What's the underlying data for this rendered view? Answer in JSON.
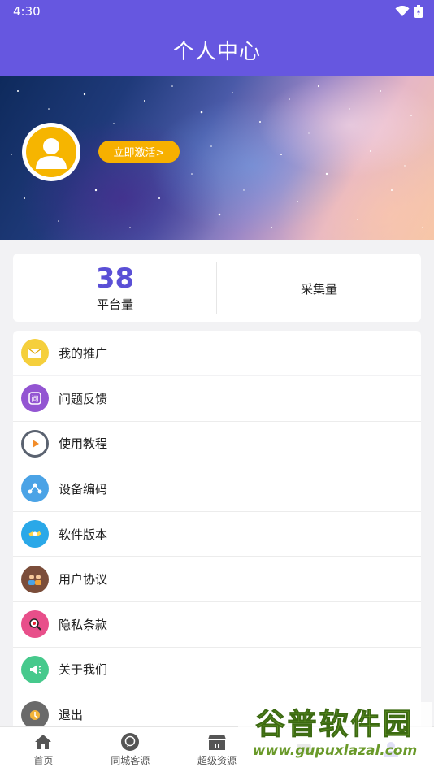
{
  "status_bar": {
    "time": "4:30"
  },
  "header": {
    "title": "个人中心"
  },
  "profile": {
    "activate_label": "立即激活>"
  },
  "stats": [
    {
      "value": "38",
      "label": "平台量"
    },
    {
      "value": "",
      "label": "采集量"
    }
  ],
  "menu": {
    "first": {
      "label": "我的推广",
      "icon": "mail-box-icon",
      "color": "#f5cf3c"
    },
    "items": [
      {
        "label": "问题反馈",
        "icon": "question-icon",
        "color": "#9355d2"
      },
      {
        "label": "使用教程",
        "icon": "play-circle-icon",
        "color": "#f28c28"
      },
      {
        "label": "设备编码",
        "icon": "network-icon",
        "color": "#4ba3e6"
      },
      {
        "label": "软件版本",
        "icon": "satellite-icon",
        "color": "#2aa8e8"
      },
      {
        "label": "用户协议",
        "icon": "users-icon",
        "color": "#7b4d3a"
      },
      {
        "label": "隐私条款",
        "icon": "magnifier-icon",
        "color": "#e84f8a"
      },
      {
        "label": "关于我们",
        "icon": "megaphone-icon",
        "color": "#46c98c"
      },
      {
        "label": "退出",
        "icon": "exit-icon",
        "color": "#6a6a6a"
      }
    ]
  },
  "tabs": [
    {
      "label": "首页",
      "icon": "home-icon"
    },
    {
      "label": "同城客源",
      "icon": "chat-icon"
    },
    {
      "label": "超级资源",
      "icon": "store-icon"
    },
    {
      "label": "",
      "icon": "tab-icon-4"
    },
    {
      "label": "",
      "icon": "profile-icon"
    }
  ],
  "watermark": {
    "title": "谷普软件园",
    "url": "www.gupuxlazal.com"
  }
}
